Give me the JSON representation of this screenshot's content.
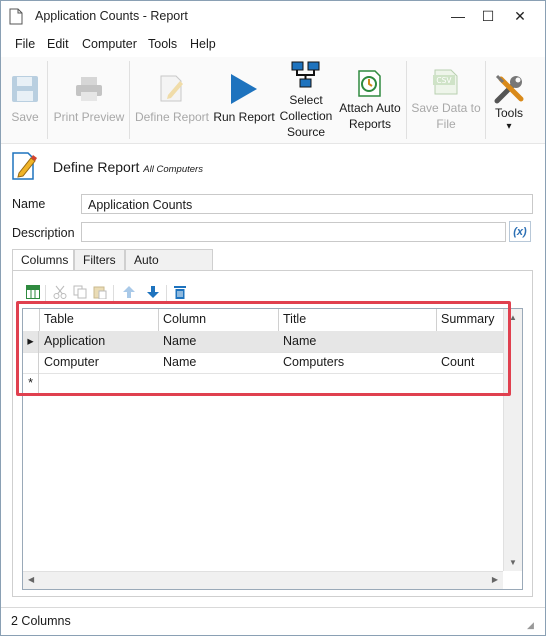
{
  "window": {
    "title": "Application Counts - Report",
    "minimize_glyph": "—",
    "maximize_glyph": "☐",
    "close_glyph": "✕"
  },
  "menu": {
    "items": [
      "File",
      "Edit",
      "Computer",
      "Tools",
      "Help"
    ]
  },
  "ribbon": {
    "save": {
      "label": "Save",
      "icon": "save-icon",
      "enabled": false
    },
    "print_preview": {
      "label": "Print Preview",
      "icon": "printer-icon",
      "enabled": false
    },
    "define_report": {
      "label": "Define Report",
      "icon": "define-report-icon",
      "enabled": false
    },
    "run_report": {
      "label": "Run Report",
      "icon": "play-icon",
      "enabled": true
    },
    "select_collection_source": {
      "line1": "Select",
      "line2": "Collection",
      "line3": "Source",
      "icon": "network-computers-icon",
      "enabled": true
    },
    "attach_auto_reports": {
      "line1": "Attach Auto",
      "line2": "Reports",
      "icon": "clock-report-icon",
      "enabled": true
    },
    "save_data_to_file": {
      "line1": "Save Data to",
      "line2": "File",
      "icon": "csv-icon",
      "icon_text": "CSV",
      "enabled": false
    },
    "tools": {
      "label": "Tools",
      "icon": "tools-icon",
      "dropdown_glyph": "▾",
      "enabled": true
    }
  },
  "header": {
    "title": "Define Report",
    "subtitle": "All Computers"
  },
  "form": {
    "name_label": "Name",
    "name_value": "Application Counts",
    "description_label": "Description",
    "description_value": "",
    "expression_button": "(x)"
  },
  "tabs": [
    {
      "label": "Columns",
      "active": true
    },
    {
      "label": "Filters",
      "active": false
    },
    {
      "label": "Auto Reports",
      "active": false
    }
  ],
  "grid": {
    "columns": [
      "Table",
      "Column",
      "Title",
      "Summary"
    ],
    "rows": [
      {
        "indicator": "▸",
        "cells": [
          "Application",
          "Name",
          "Name",
          ""
        ],
        "selected": true
      },
      {
        "indicator": "",
        "cells": [
          "Computer",
          "Name",
          "Computers",
          "Count"
        ],
        "selected": false
      }
    ],
    "new_row_indicator": "*"
  },
  "status": {
    "text": "2 Columns"
  },
  "colors": {
    "highlight": "#e0404f",
    "accent": "#1e73be",
    "play": "#1e73be"
  }
}
